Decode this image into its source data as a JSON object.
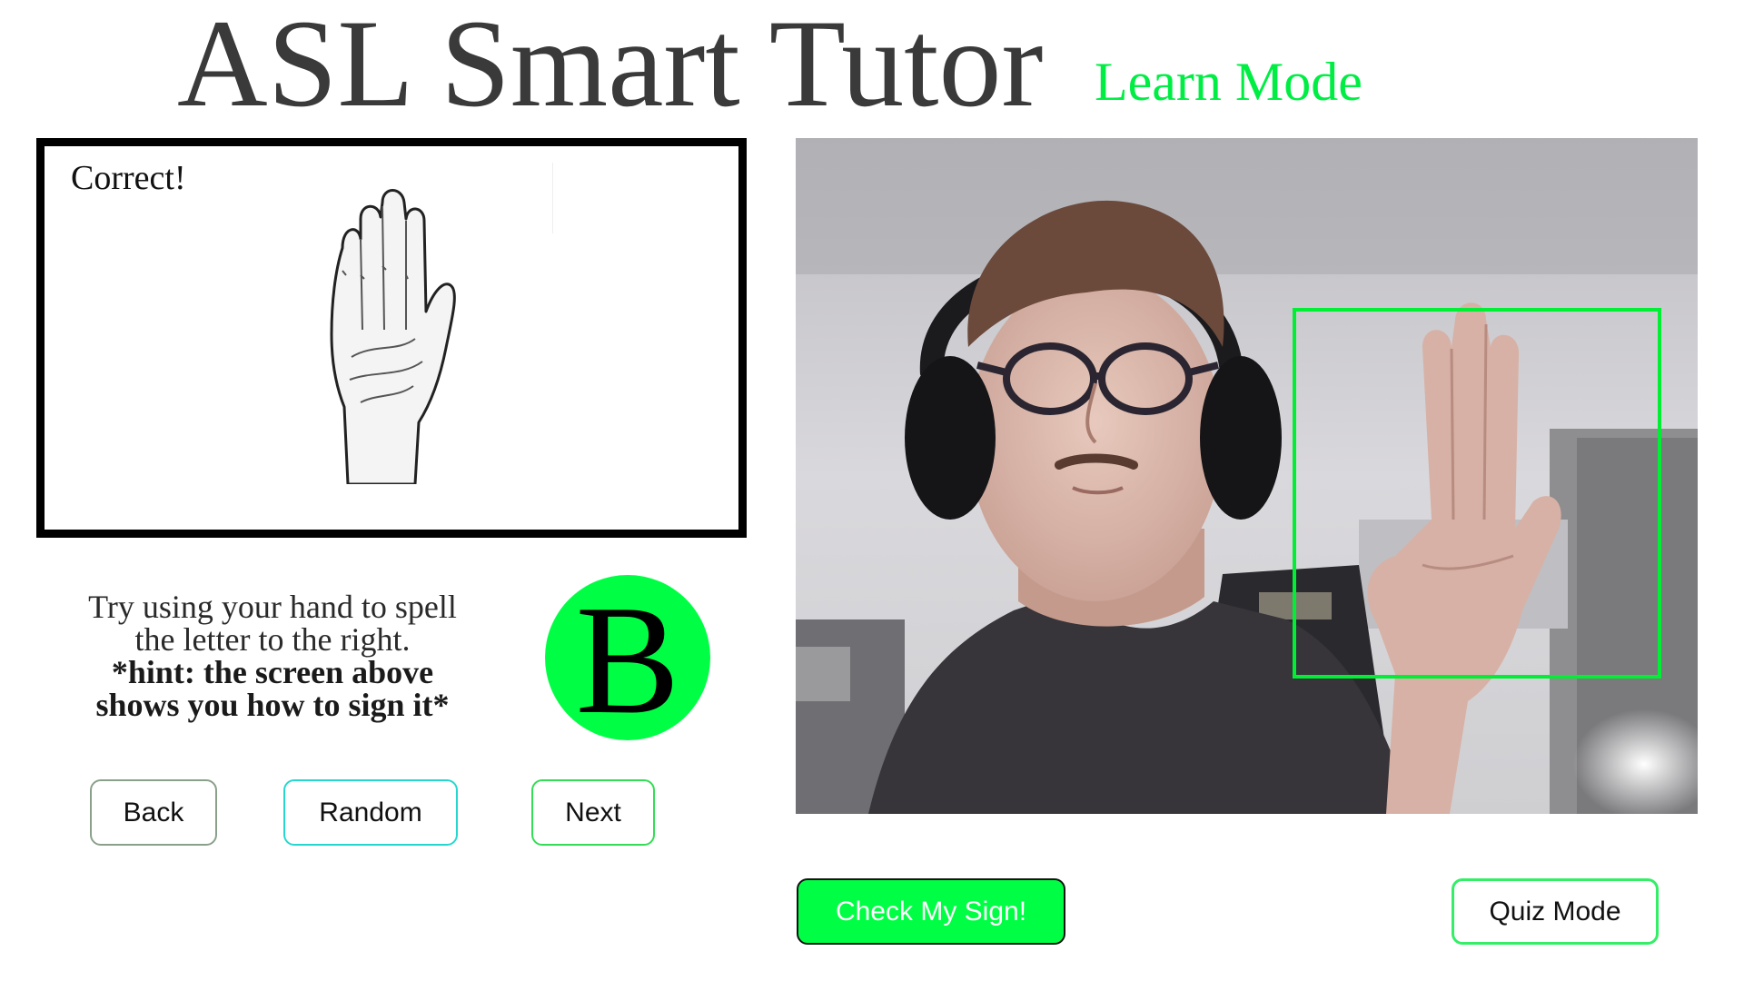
{
  "header": {
    "title": "ASL Smart Tutor",
    "mode": "Learn Mode"
  },
  "reference": {
    "feedback": "Correct!",
    "illustration_icon": "open-palm-hand-icon"
  },
  "instructions": {
    "line1": "Try using your hand to spell",
    "line2": "the letter to the right.",
    "hint1": "*hint: the screen above",
    "hint2": "shows you how to sign it*"
  },
  "target": {
    "letter": "B"
  },
  "nav": {
    "back": "Back",
    "random": "Random",
    "next": "Next"
  },
  "camera": {
    "detection_color": "#00ee33"
  },
  "actions": {
    "check": "Check My Sign!",
    "quiz": "Quiz Mode"
  },
  "colors": {
    "accent_green": "#00ff44",
    "title_gray": "#3a3a3a",
    "mode_green": "#00ee44"
  }
}
